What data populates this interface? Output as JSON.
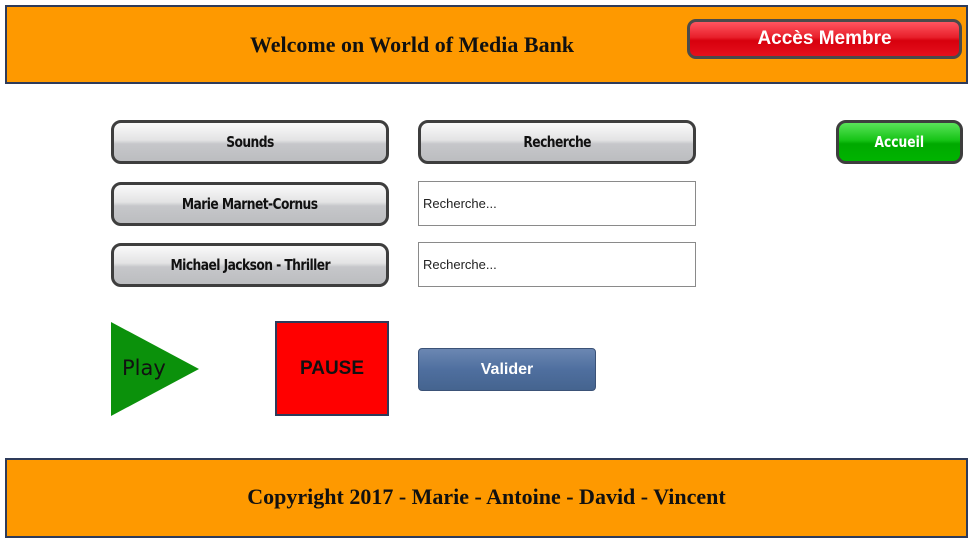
{
  "header": {
    "title": "Welcome on World of Media Bank",
    "member_button": "Accès Membre"
  },
  "nav": {
    "sounds": "Sounds",
    "recherche": "Recherche",
    "accueil": "Accueil"
  },
  "tracks": [
    {
      "label": "Marie Marnet-Cornus"
    },
    {
      "label": "Michael Jackson - Thriller"
    }
  ],
  "search": {
    "field1_placeholder": "Recherche...",
    "field2_placeholder": "Recherche..."
  },
  "player": {
    "play_label": "Play",
    "pause_label": "PAUSE"
  },
  "form": {
    "submit_label": "Valider"
  },
  "footer": {
    "text": "Copyright 2017 - Marie - Antoine - David - Vincent"
  },
  "colors": {
    "banner": "#fe9900",
    "member_button": "#e8202b",
    "accueil_button": "#17c417",
    "play": "#0b910b",
    "pause": "#ff0000",
    "valider": "#4f6f9f"
  }
}
